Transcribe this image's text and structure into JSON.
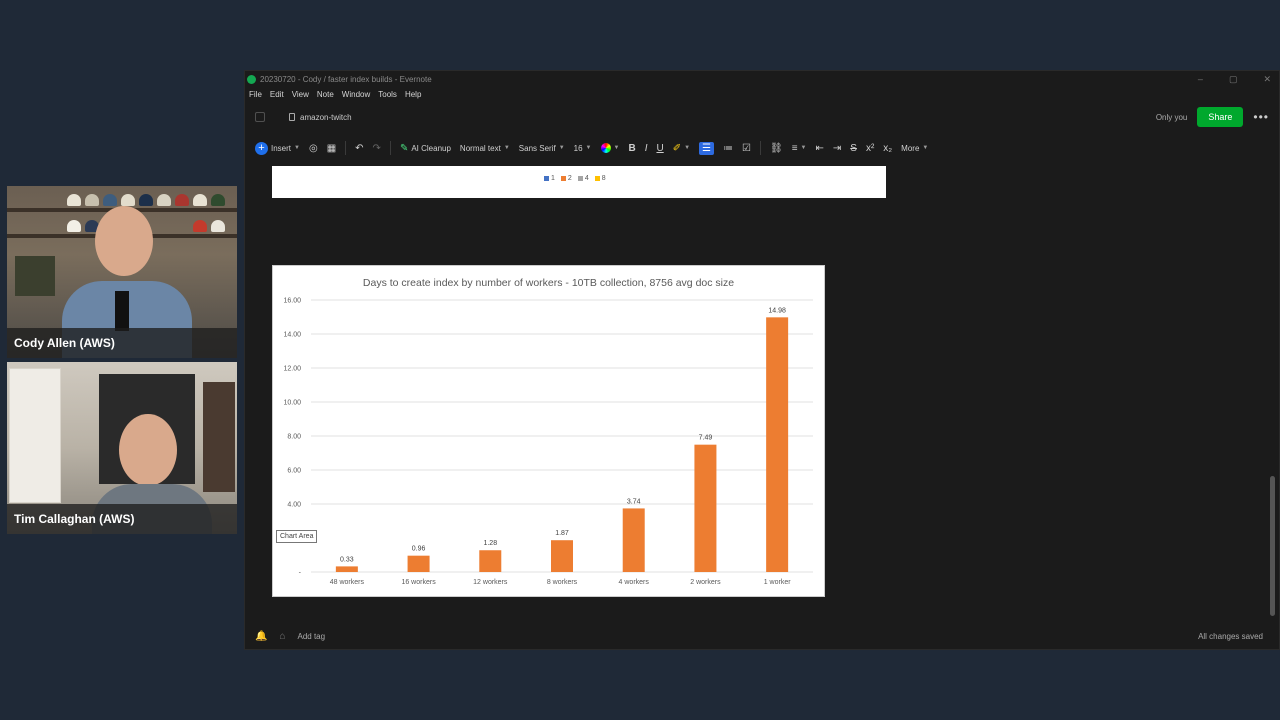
{
  "participants": [
    {
      "name": "Cody Allen (AWS)"
    },
    {
      "name": "Tim Callaghan (AWS)"
    }
  ],
  "window": {
    "title": "20230720 - Cody / faster index builds - Evernote",
    "controls": [
      "–",
      "▢",
      "✕"
    ],
    "menu": [
      "File",
      "Edit",
      "View",
      "Note",
      "Window",
      "Tools",
      "Help"
    ]
  },
  "notebar": {
    "notebook": "amazon-twitch",
    "visibility": "Only you",
    "share_label": "Share",
    "more_icon": "more-dots-icon"
  },
  "toolbar": {
    "insert_label": "Insert",
    "ai_cleanup_label": "AI Cleanup",
    "style_label": "Normal text",
    "font_label": "Sans Serif",
    "size_label": "16",
    "more_label": "More"
  },
  "legend": {
    "items": [
      {
        "label": "1",
        "color": "#4472c4"
      },
      {
        "label": "2",
        "color": "#ed7d31"
      },
      {
        "label": "4",
        "color": "#a5a5a5"
      },
      {
        "label": "8",
        "color": "#ffc000"
      }
    ]
  },
  "chart_area_tag": "Chart Area",
  "chart_data": {
    "type": "bar",
    "title": "Days to create index by number of workers - 10TB collection, 8756 avg doc size",
    "categories": [
      "48 workers",
      "16 workers",
      "12 workers",
      "8 workers",
      "4 workers",
      "2 workers",
      "1 worker"
    ],
    "values": [
      0.33,
      0.96,
      1.28,
      1.87,
      3.74,
      7.49,
      14.98
    ],
    "data_labels": [
      "0.33",
      "0.96",
      "1.28",
      "1.87",
      "3.74",
      "7.49",
      "14.98"
    ],
    "y_ticks": [
      "-",
      "4.00",
      "6.00",
      "8.00",
      "10.00",
      "12.00",
      "14.00",
      "16.00"
    ],
    "ylim": [
      0,
      16
    ],
    "grid": true,
    "bar_color": "#ed7d31"
  },
  "footer": {
    "add_tag": "Add tag",
    "status": "All changes saved"
  }
}
